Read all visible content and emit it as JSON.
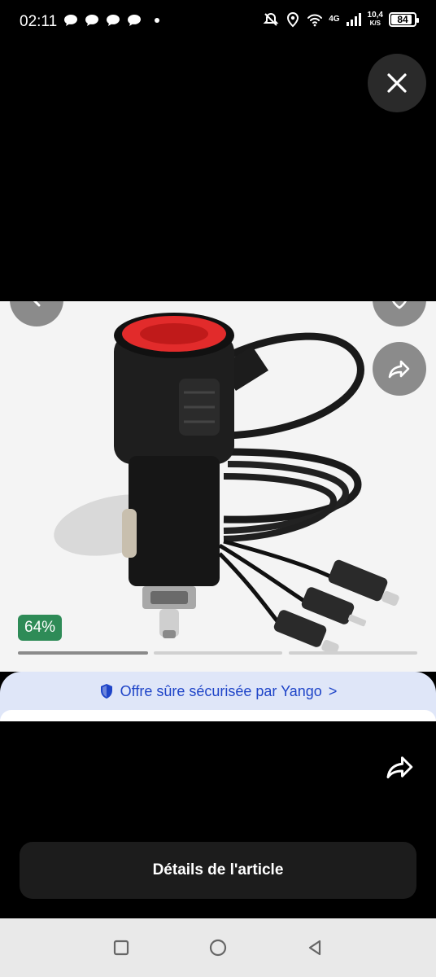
{
  "status_bar": {
    "time": "02:11",
    "network": "4G",
    "speed_value": "10,4",
    "speed_unit": "K/S",
    "battery": "84"
  },
  "product": {
    "discount": "64%",
    "image_count": 3,
    "active_image": 1
  },
  "secure_banner": {
    "text": "Offre sûre sécurisée par Yango",
    "chevron": ">"
  },
  "actions": {
    "details_label": "Détails de l'article"
  },
  "icons": {
    "close": "close-icon",
    "back": "chevron-left-icon",
    "favorite": "heart-icon",
    "share": "share-icon",
    "shield": "shield-icon",
    "nav_recent": "square-icon",
    "nav_home": "circle-icon",
    "nav_back": "triangle-back-icon"
  },
  "colors": {
    "discount_badge": "#2e8b57",
    "secure_text": "#1e44c8",
    "secure_bg": "#dfe6f8"
  }
}
